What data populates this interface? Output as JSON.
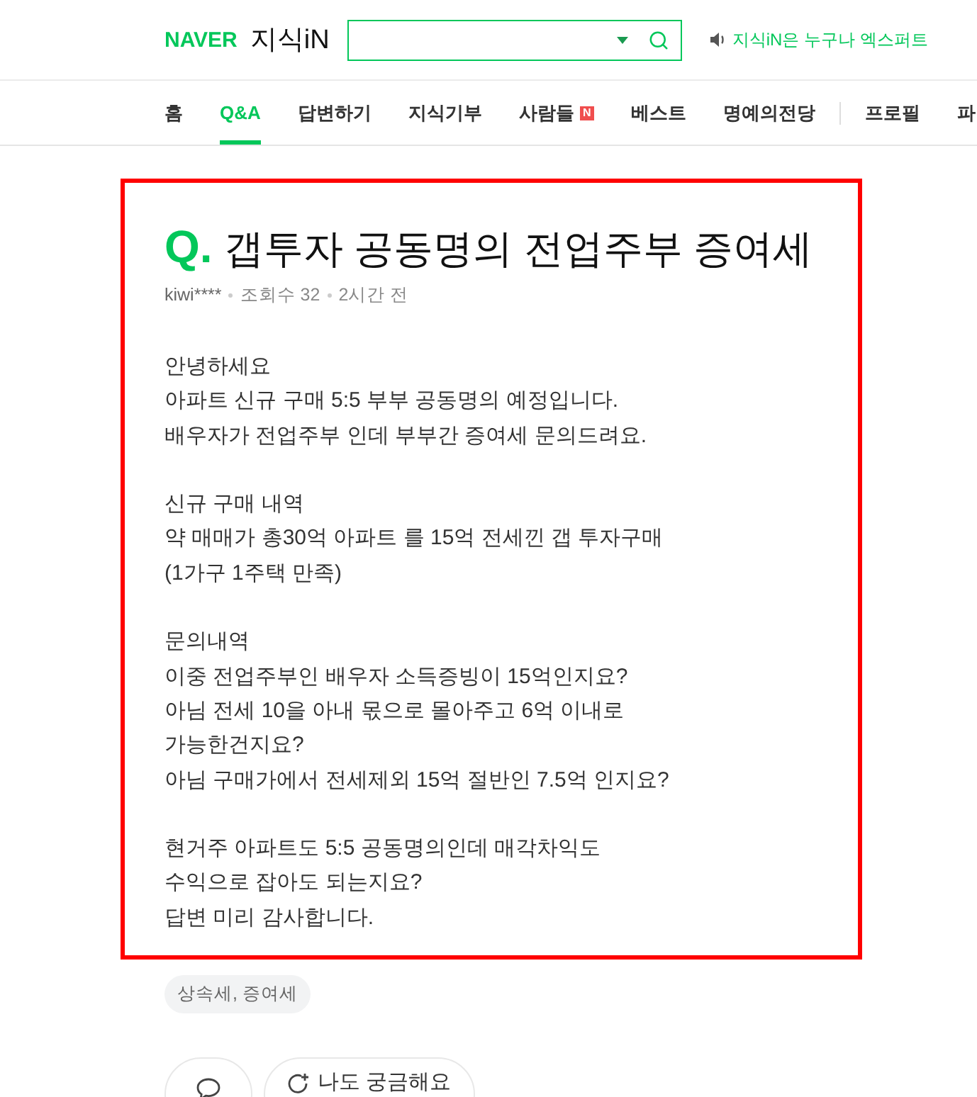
{
  "header": {
    "logo": {
      "brand": "NAVER",
      "service": "지식iN"
    },
    "notice": "지식iN은 누구나 엑스퍼트"
  },
  "nav": {
    "items": [
      {
        "label": "홈",
        "selected": false
      },
      {
        "label": "Q&A",
        "selected": true
      },
      {
        "label": "답변하기",
        "selected": false
      },
      {
        "label": "지식기부",
        "selected": false
      },
      {
        "label": "사람들",
        "selected": false,
        "badge": "N"
      },
      {
        "label": "베스트",
        "selected": false
      },
      {
        "label": "명예의전당",
        "selected": false
      }
    ],
    "user_items": [
      {
        "label": "프로필",
        "selected": false
      },
      {
        "label": "파",
        "selected": false
      }
    ]
  },
  "question": {
    "mark": "Q.",
    "title": "갭투자 공동명의 전업주부 증여세",
    "meta": {
      "author": "kiwi****",
      "views": "조회수 32",
      "time": "2시간 전"
    },
    "paragraphs": [
      "안녕하세요\n아파트 신규 구매 5:5 부부 공동명의 예정입니다.\n배우자가 전업주부 인데 부부간 증여세 문의드려요.",
      "신규 구매 내역\n약 매매가 총30억 아파트 를 15억 전세낀 갭 투자구매\n(1가구 1주택 만족)",
      "문의내역\n이중 전업주부인 배우자 소득증빙이 15억인지요?\n아님 전세 10을 아내 몫으로 몰아주고 6억 이내로\n가능한건지요?\n아님 구매가에서 전세제외 15억 절반인 7.5억 인지요?",
      "현거주 아파트도 5:5 공동명의인데 매각차익도\n수익으로 잡아도 되는지요?\n답변 미리 감사합니다."
    ],
    "tags": [
      "상속세, 증여세"
    ]
  },
  "actions": [
    {
      "kind": "comment"
    },
    {
      "kind": "curious",
      "label": "나도 궁금해요"
    }
  ]
}
